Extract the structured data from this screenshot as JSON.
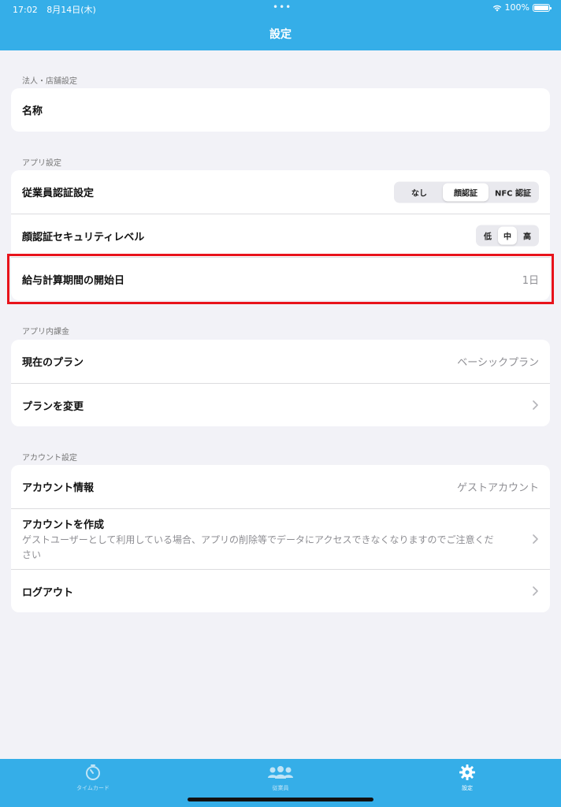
{
  "status_bar": {
    "time": "17:02",
    "date": "8月14日(木)",
    "dots": "•••",
    "battery_text": "100%"
  },
  "nav": {
    "title": "設定"
  },
  "sections": {
    "corporate": {
      "header": "法人・店舗設定",
      "name_label": "名称"
    },
    "app": {
      "header": "アプリ設定",
      "employee_auth_label": "従業員認証設定",
      "employee_auth_options": [
        "なし",
        "顔認証",
        "NFC 認証"
      ],
      "employee_auth_selected": "顔認証",
      "face_security_label": "顔認証セキュリティレベル",
      "face_security_options": [
        "低",
        "中",
        "高"
      ],
      "face_security_selected": "中",
      "payroll_start_label": "給与計算期間の開始日",
      "payroll_start_value": "1日"
    },
    "billing": {
      "header": "アプリ内課金",
      "current_plan_label": "現在のプラン",
      "current_plan_value": "ベーシックプラン",
      "change_plan_label": "プランを変更"
    },
    "account": {
      "header": "アカウント設定",
      "info_label": "アカウント情報",
      "info_value": "ゲストアカウント",
      "create_label": "アカウントを作成",
      "create_sub": "ゲストユーザーとして利用している場合、アプリの削除等でデータにアクセスできなくなりますのでご注意ください",
      "logout_label": "ログアウト"
    }
  },
  "tabbar": {
    "items": [
      {
        "label": "タイムカード",
        "icon": "timer-icon"
      },
      {
        "label": "従業員",
        "icon": "people-icon"
      },
      {
        "label": "設定",
        "icon": "gear-icon",
        "active": true
      }
    ]
  },
  "colors": {
    "accent": "#35aee8",
    "highlight": "#e8131b",
    "background": "#f2f2f7"
  }
}
